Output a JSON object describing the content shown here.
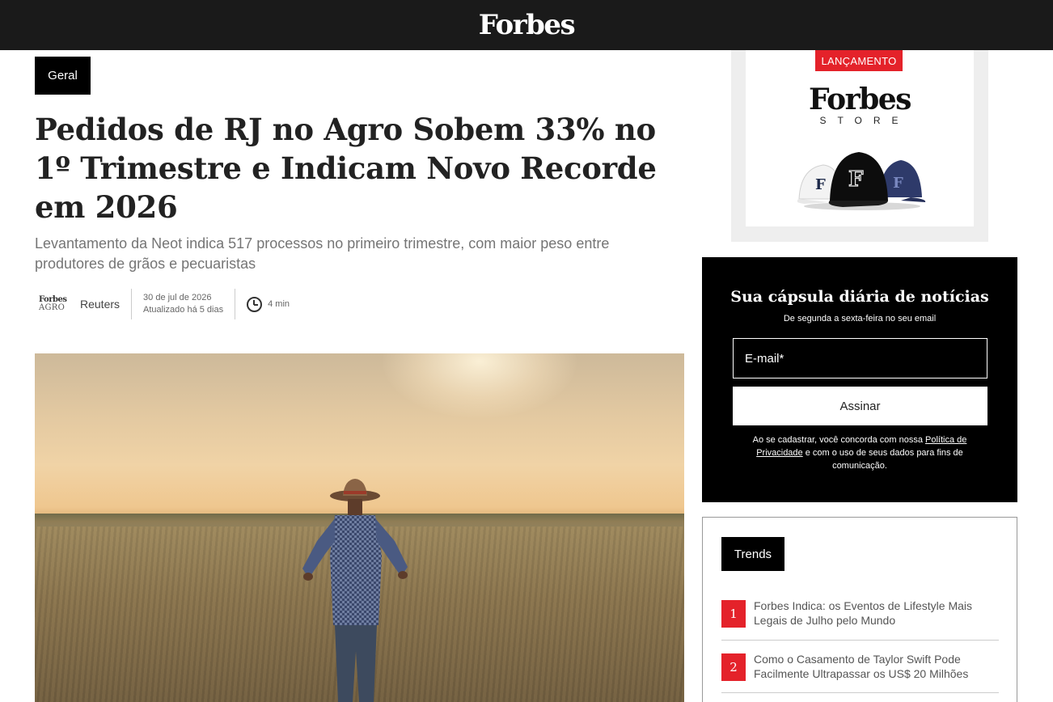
{
  "header": {
    "logo": "Forbes"
  },
  "article": {
    "category": "Geral",
    "title": "Pedidos de RJ no Agro Sobem 33% no 1º Trimestre e Indicam Novo Recorde em 2026",
    "subtitle": "Levantamento da Neot indica 517 processos no primeiro trimestre, com maior peso entre produtores de grãos e pecuaristas",
    "source_logo_line1": "Forbes",
    "source_logo_line2": "AGRO",
    "author": "Reuters",
    "date": "30 de jul de 2026",
    "updated": "Atualizado há 5 dias",
    "read_time": "4 min"
  },
  "ad": {
    "badge": "LANÇAMENTO",
    "brand": "Forbes",
    "store": "STORE"
  },
  "newsletter": {
    "title": "Sua cápsula diária de notícias",
    "subtitle": "De segunda a sexta-feira no seu email",
    "email_placeholder": "E-mail*",
    "button_label": "Assinar",
    "legal_before": "Ao se cadastrar, você concorda com nossa ",
    "legal_link": "Política de Privacidade",
    "legal_after": " e com o uso de seus dados para fins de comunicação."
  },
  "trends": {
    "label": "Trends",
    "items": [
      {
        "number": "1",
        "title": "Forbes Indica: os Eventos de Lifestyle Mais Legais de Julho pelo Mundo"
      },
      {
        "number": "2",
        "title": "Como o Casamento de Taylor Swift Pode Facilmente Ultrapassar os US$ 20 Milhões"
      }
    ]
  },
  "colors": {
    "accent_red": "#e4222a",
    "topbar": "#1a1a1a"
  }
}
